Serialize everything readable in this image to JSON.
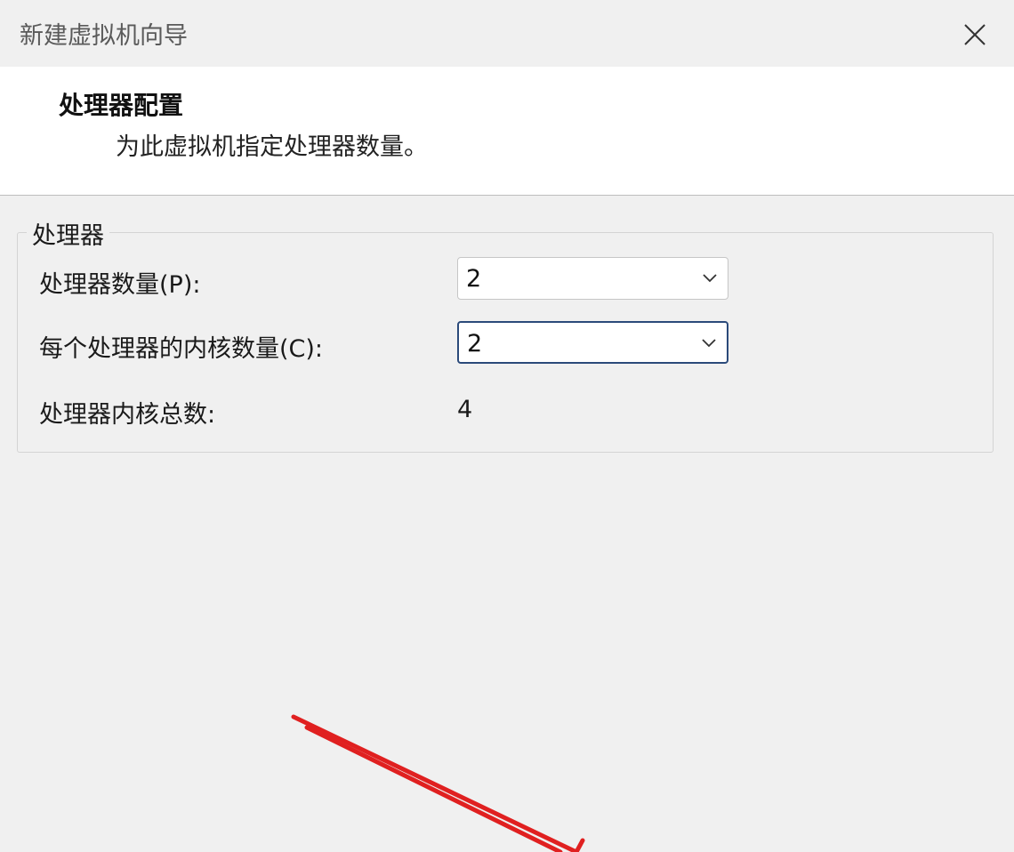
{
  "window": {
    "title": "新建虚拟机向导",
    "close_icon": "close-icon"
  },
  "header": {
    "title": "处理器配置",
    "subtitle": "为此虚拟机指定处理器数量。"
  },
  "processor_group": {
    "legend": "处理器",
    "processor_count": {
      "label": "处理器数量(P):",
      "value": "2"
    },
    "cores_per_processor": {
      "label": "每个处理器的内核数量(C):",
      "value": "2"
    },
    "total_cores": {
      "label": "处理器内核总数:",
      "value": "4"
    }
  },
  "annotation": {
    "arrow_color": "#e02020",
    "arrow_icon": "red-arrow-annotation"
  }
}
